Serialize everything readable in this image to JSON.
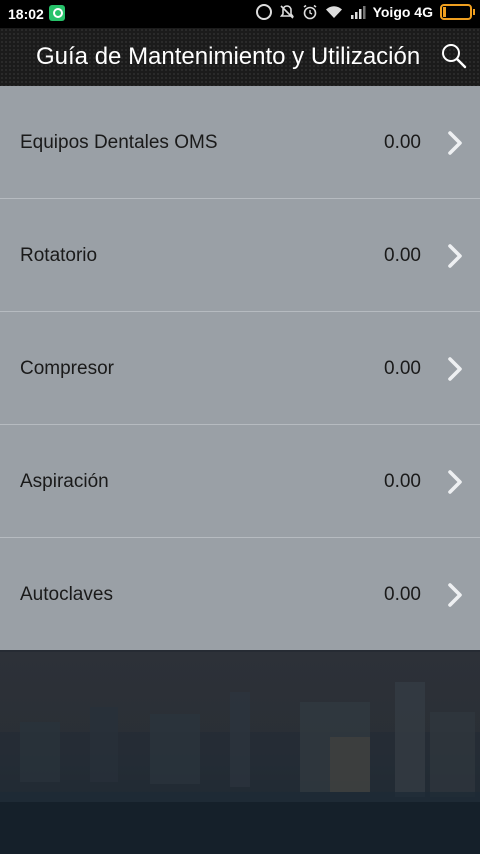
{
  "status_bar": {
    "time": "18:02",
    "carrier": "Yoigo 4G",
    "battery_level": 0.1,
    "icons": [
      "whatsapp-icon",
      "circle-status-icon",
      "bell-off-icon",
      "alarm-icon",
      "wifi-icon",
      "signal-icon",
      "battery-icon"
    ]
  },
  "header": {
    "title": "Guía de Mantenimiento y Utilización",
    "search_icon": "search-icon"
  },
  "list": {
    "items": [
      {
        "label": "Equipos Dentales OMS",
        "value": "0.00"
      },
      {
        "label": "Rotatorio",
        "value": "0.00"
      },
      {
        "label": "Compresor",
        "value": "0.00"
      },
      {
        "label": "Aspiración",
        "value": "0.00"
      },
      {
        "label": "Autoclaves",
        "value": "0.00"
      }
    ]
  },
  "colors": {
    "list_background": "#9aa0a6",
    "header_background": "#1b1b1b",
    "battery": "#f0a020",
    "status_app_icon": "#27c26a"
  }
}
